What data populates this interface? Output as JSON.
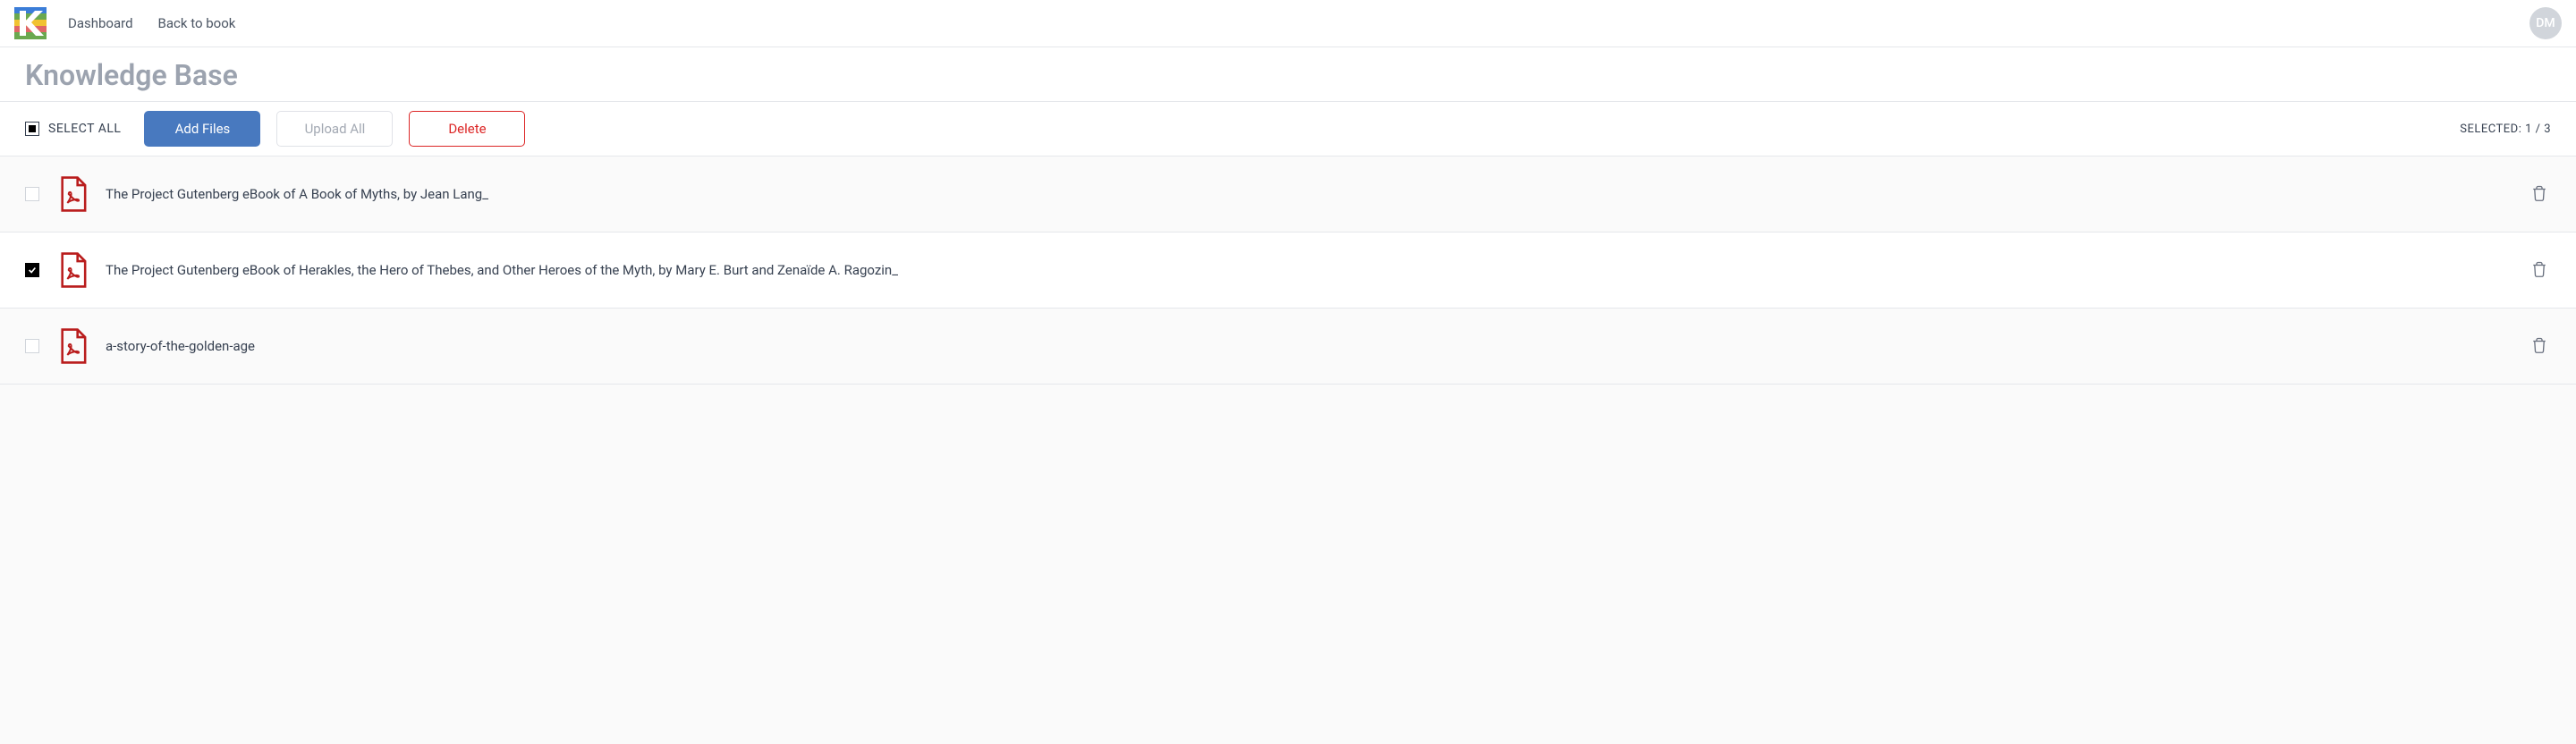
{
  "header": {
    "nav": {
      "dashboard": "Dashboard",
      "back_to_book": "Back to book"
    },
    "avatar_initials": "DM"
  },
  "page": {
    "title": "Knowledge Base"
  },
  "toolbar": {
    "select_all_label": "SELECT ALL",
    "add_files_label": "Add Files",
    "upload_all_label": "Upload All",
    "delete_label": "Delete",
    "selected_label": "SELECTED: 1 / 3"
  },
  "files": [
    {
      "name": "The Project Gutenberg eBook of A Book of Myths, by Jean Lang_",
      "checked": false
    },
    {
      "name": "The Project Gutenberg eBook of Herakles, the Hero of Thebes, and Other Heroes of the Myth, by Mary E. Burt and Zenaïde A. Ragozin_",
      "checked": true
    },
    {
      "name": "a-story-of-the-golden-age",
      "checked": false
    }
  ]
}
